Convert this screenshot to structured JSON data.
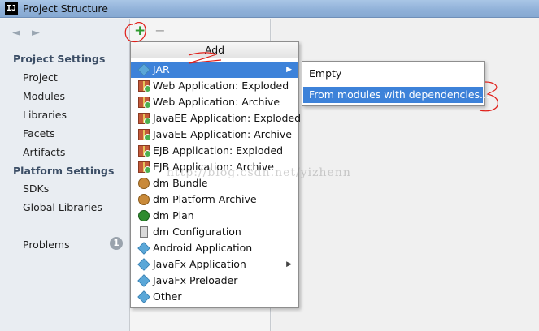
{
  "window": {
    "title": "Project Structure",
    "app_icon_text": "IJ"
  },
  "toolbar": {
    "back_icon": "arrow-left-icon",
    "forward_icon": "arrow-right-icon",
    "add_symbol": "+",
    "remove_symbol": "−"
  },
  "sidebar": {
    "project_settings_title": "Project Settings",
    "project_items": [
      "Project",
      "Modules",
      "Libraries",
      "Facets",
      "Artifacts"
    ],
    "platform_settings_title": "Platform Settings",
    "platform_items": [
      "SDKs",
      "Global Libraries"
    ],
    "problems_label": "Problems",
    "problems_count": "1"
  },
  "add_menu": {
    "header": "Add",
    "items": [
      {
        "label": "JAR",
        "icon": "diamond-icon",
        "submenu": true,
        "selected": true
      },
      {
        "label": "Web Application: Exploded",
        "icon": "gift-icon"
      },
      {
        "label": "Web Application: Archive",
        "icon": "gift-icon"
      },
      {
        "label": "JavaEE Application: Exploded",
        "icon": "gift-icon"
      },
      {
        "label": "JavaEE Application: Archive",
        "icon": "gift-icon"
      },
      {
        "label": "EJB Application: Exploded",
        "icon": "gift-icon"
      },
      {
        "label": "EJB Application: Archive",
        "icon": "gift-icon"
      },
      {
        "label": "dm Bundle",
        "icon": "bundle-icon"
      },
      {
        "label": "dm Platform Archive",
        "icon": "bundle-icon"
      },
      {
        "label": "dm Plan",
        "icon": "plan-icon"
      },
      {
        "label": "dm Configuration",
        "icon": "document-icon"
      },
      {
        "label": "Android Application",
        "icon": "diamond-icon"
      },
      {
        "label": "JavaFx Application",
        "icon": "diamond-icon",
        "submenu": true
      },
      {
        "label": "JavaFx Preloader",
        "icon": "diamond-icon"
      },
      {
        "label": "Other",
        "icon": "diamond-icon"
      }
    ]
  },
  "sub_menu": {
    "items": [
      {
        "label": "Empty"
      },
      {
        "label": "From modules with dependencies...",
        "selected": true
      }
    ]
  },
  "watermark": "http://blog.csdn.net/yizhenn",
  "colors": {
    "selection": "#3d82d9",
    "annotation": "#e0201a",
    "add_green": "#2f9b2f"
  }
}
